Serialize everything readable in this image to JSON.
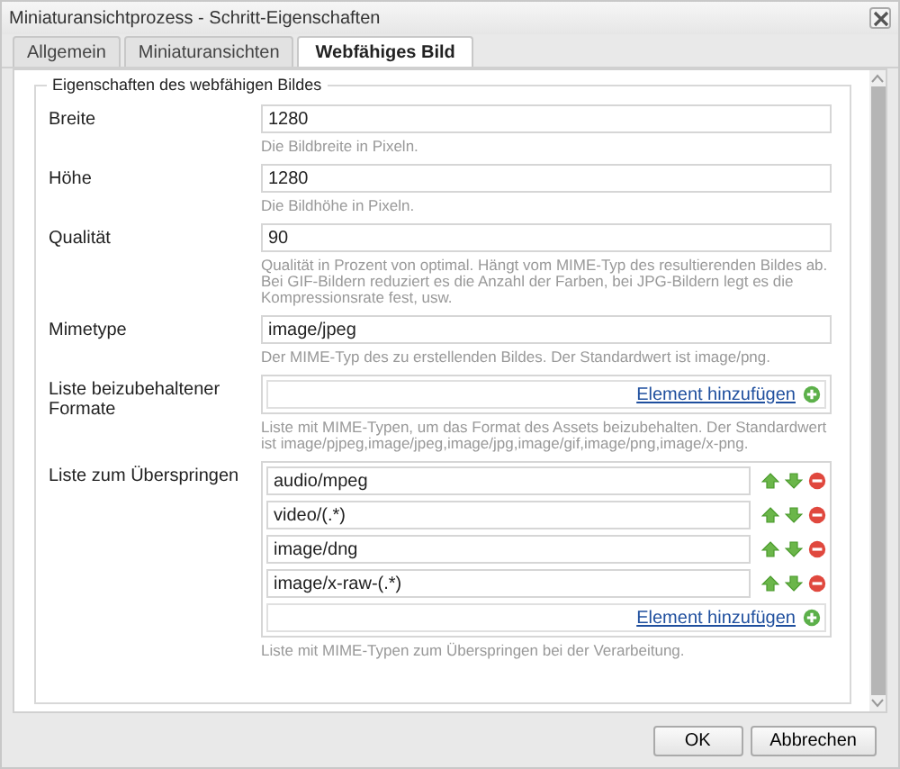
{
  "window": {
    "title": "Miniaturansichtprozess - Schritt-Eigenschaften"
  },
  "tabs": [
    {
      "label": "Allgemein",
      "selected": false
    },
    {
      "label": "Miniaturansichten",
      "selected": false
    },
    {
      "label": "Webfähiges Bild",
      "selected": true
    }
  ],
  "fieldset": {
    "legend": "Eigenschaften des webfähigen Bildes",
    "fields": [
      {
        "kind": "text",
        "label": "Breite",
        "value": "1280",
        "help": "Die Bildbreite in Pixeln."
      },
      {
        "kind": "text",
        "label": "Höhe",
        "value": "1280",
        "help": "Die Bildhöhe in Pixeln."
      },
      {
        "kind": "text",
        "label": "Qualität",
        "value": "90",
        "help": "Qualität in Prozent von optimal. Hängt vom MIME-Typ des resultierenden Bildes ab. Bei GIF-Bildern reduziert es die Anzahl der Farben, bei JPG-Bildern legt es die Kompressionsrate fest, usw."
      },
      {
        "kind": "text",
        "label": "Mimetype",
        "value": "image/jpeg",
        "help": "Der MIME-Typ des zu erstellenden Bildes. Der Standardwert ist image/png."
      },
      {
        "kind": "list",
        "label": "Liste beizubehaltener Formate",
        "add_link": "Element hinzufügen",
        "help": "Liste mit MIME-Typen, um das Format des Assets beizubehalten. Der Standardwert ist image/pjpeg,image/jpeg,image/jpg,image/gif,image/png,image/x-png."
      },
      {
        "kind": "list",
        "label": "Liste zum Überspringen",
        "items": [
          "audio/mpeg",
          "video/(.*)",
          "image/dng",
          "image/x-raw-(.*)"
        ],
        "add_link": "Element hinzufügen",
        "help": "Liste mit MIME-Typen zum Überspringen bei der Verarbeitung."
      }
    ]
  },
  "buttons": [
    "OK",
    "Abbrechen"
  ]
}
